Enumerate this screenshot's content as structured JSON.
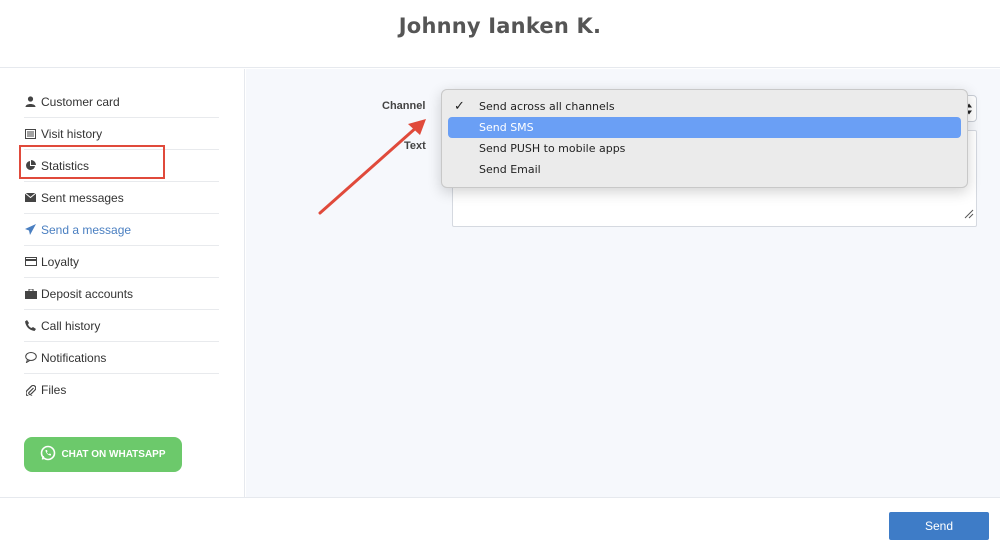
{
  "header": {
    "title": "Johnny Ianken K."
  },
  "sidebar": {
    "items": [
      {
        "label": "Customer card",
        "icon": "user-icon"
      },
      {
        "label": "Visit history",
        "icon": "list-icon"
      },
      {
        "label": "Statistics",
        "icon": "pie-chart-icon"
      },
      {
        "label": "Sent messages",
        "icon": "envelope-icon"
      },
      {
        "label": "Send a message",
        "icon": "paper-plane-icon",
        "active": true
      },
      {
        "label": "Loyalty",
        "icon": "credit-card-icon"
      },
      {
        "label": "Deposit accounts",
        "icon": "briefcase-icon"
      },
      {
        "label": "Call history",
        "icon": "phone-icon"
      },
      {
        "label": "Notifications",
        "icon": "speech-bubble-icon"
      },
      {
        "label": "Files",
        "icon": "paperclip-icon"
      }
    ],
    "whatsapp_label": "CHAT ON WHATSAPP"
  },
  "form": {
    "channel_label": "Channel",
    "text_label": "Text",
    "channel_options": [
      {
        "label": "Send across all channels",
        "checked": true
      },
      {
        "label": "Send SMS",
        "highlighted": true
      },
      {
        "label": "Send PUSH to mobile apps"
      },
      {
        "label": "Send Email"
      }
    ]
  },
  "footer": {
    "send_label": "Send"
  },
  "colors": {
    "accent": "#3e7cc7",
    "active_link": "#4a7fc1",
    "highlight": "#6a9ff5",
    "annotation": "#e04a3b",
    "whatsapp": "#6cc96b"
  }
}
